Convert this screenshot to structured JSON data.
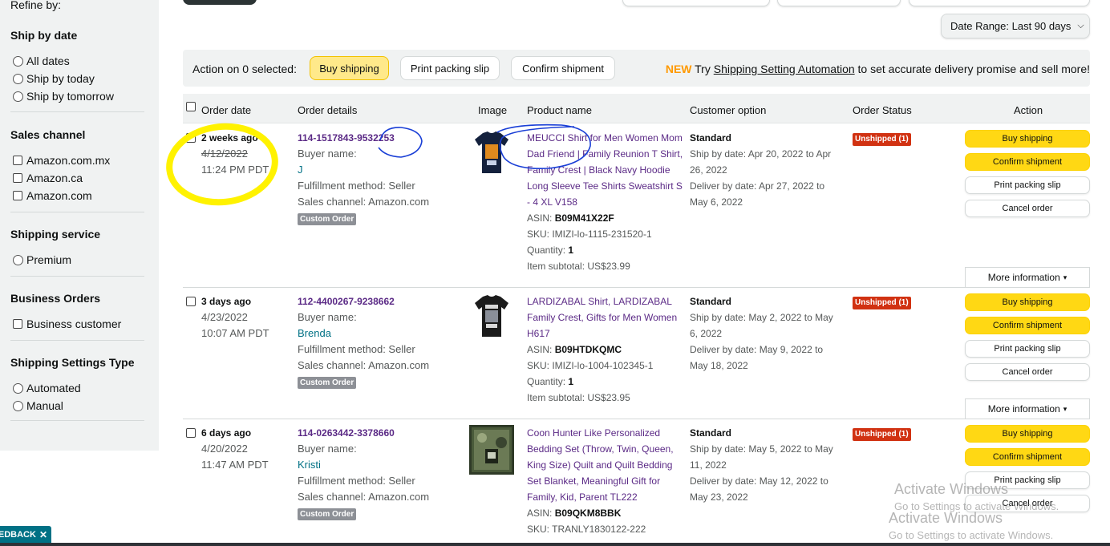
{
  "sidebar": {
    "refine_label": "Refine by:",
    "ship_by_date": {
      "heading": "Ship by date",
      "options": [
        "All dates",
        "Ship by today",
        "Ship by tomorrow"
      ]
    },
    "sales_channel": {
      "heading": "Sales channel",
      "options": [
        "Amazon.com.mx",
        "Amazon.ca",
        "Amazon.com"
      ]
    },
    "shipping_service": {
      "heading": "Shipping service",
      "options": [
        "Premium"
      ]
    },
    "business_orders": {
      "heading": "Business Orders",
      "options": [
        "Business customer"
      ]
    },
    "shipping_settings_type": {
      "heading": "Shipping Settings Type",
      "options": [
        "Automated",
        "Manual"
      ]
    }
  },
  "date_range": {
    "label": "Date Range: Last 90 days"
  },
  "action_bar": {
    "selected_label": "Action on 0 selected:",
    "buy_shipping": "Buy shipping",
    "print_packing_slip": "Print packing slip",
    "confirm_shipment": "Confirm shipment",
    "promo_new": "NEW",
    "promo_try": "Try",
    "promo_link": "Shipping Setting Automation",
    "promo_rest": "to set accurate delivery promise and sell more!"
  },
  "table": {
    "headers": {
      "order_date": "Order date",
      "order_details": "Order details",
      "image": "Image",
      "product_name": "Product name",
      "customer_option": "Customer option",
      "order_status": "Order Status",
      "action": "Action"
    },
    "orders": [
      {
        "age": "2 weeks ago",
        "date": "4/12/2022",
        "time": "11:24 PM PDT",
        "order_id": "114-1517843-9532253",
        "buyer_label": "Buyer name:",
        "buyer": "J",
        "fulfillment": "Fulfillment method: Seller",
        "channel": "Sales channel: Amazon.com",
        "badge": "Custom Order",
        "product_name": "MEUCCI Shirt for Men Women Mom Dad Friend | Family Reunion T Shirt, Family Crest | Black Navy Hoodie Long Sleeve Tee Shirts Sweatshirt S - 4 XL V158",
        "asin_label": "ASIN:",
        "asin": "B09M41X22F",
        "sku": "SKU: IMIZI-lo-1115-231520-1",
        "qty_label": "Quantity:",
        "qty": "1",
        "subtotal": "Item subtotal: US$23.99",
        "shipping": "Standard",
        "ship_by": "Ship by date: Apr 20, 2022 to Apr 26, 2022",
        "deliver_by": "Deliver by date: Apr 27, 2022 to May 6, 2022",
        "status": "Unshipped (1)",
        "btn_buy": "Buy shipping",
        "btn_confirm": "Confirm shipment",
        "btn_print": "Print packing slip",
        "btn_cancel": "Cancel order",
        "more_info": "More information"
      },
      {
        "age": "3 days ago",
        "date": "4/23/2022",
        "time": "10:07 AM PDT",
        "order_id": "112-4400267-9238662",
        "buyer_label": "Buyer name:",
        "buyer": "Brenda",
        "fulfillment": "Fulfillment method: Seller",
        "channel": "Sales channel: Amazon.com",
        "badge": "Custom Order",
        "product_name": "LARDIZABAL Shirt, LARDIZABAL Family Crest, Gifts for Men Women H617",
        "asin_label": "ASIN:",
        "asin": "B09HTDKQMC",
        "sku": "SKU: IMIZI-lo-1004-102345-1",
        "qty_label": "Quantity:",
        "qty": "1",
        "subtotal": "Item subtotal: US$23.95",
        "shipping": "Standard",
        "ship_by": "Ship by date: May 2, 2022 to May 6, 2022",
        "deliver_by": "Deliver by date: May 9, 2022 to May 18, 2022",
        "status": "Unshipped (1)",
        "btn_buy": "Buy shipping",
        "btn_confirm": "Confirm shipment",
        "btn_print": "Print packing slip",
        "btn_cancel": "Cancel order",
        "more_info": "More information"
      },
      {
        "age": "6 days ago",
        "date": "4/20/2022",
        "time": "11:47 AM PDT",
        "order_id": "114-0263442-3378660",
        "buyer_label": "Buyer name:",
        "buyer": "Kristi",
        "fulfillment": "Fulfillment method: Seller",
        "channel": "Sales channel: Amazon.com",
        "badge": "Custom Order",
        "product_name": "Coon Hunter Like Personalized Bedding Set (Throw, Twin, Queen, King Size) Quilt and Quilt Bedding Set Blanket, Meaningful Gift for Family, Kid, Parent TL222",
        "asin_label": "ASIN:",
        "asin": "B09QKM8BBK",
        "sku": "SKU: TRANLY1830122-222",
        "shipping": "Standard",
        "ship_by": "Ship by date: May 5, 2022 to May 11, 2022",
        "deliver_by": "Deliver by date: May 12, 2022 to May 23, 2022",
        "status": "Unshipped (1)",
        "btn_buy": "Buy shipping",
        "btn_confirm": "Confirm shipment",
        "btn_print": "Print packing slip",
        "btn_cancel": "Cancel order"
      }
    ]
  },
  "feedback": {
    "label": "EEDBACK",
    "close": "✕"
  },
  "watermark": {
    "title": "Activate Windows",
    "subtitle": "Go to Settings to activate Windows."
  },
  "colors": {
    "buy_shipping": "#ffd814",
    "status_red": "#d13212",
    "order_id_purple": "#5b2a86",
    "annotation_yellow": "#fff200",
    "annotation_blue": "#1a3fd6"
  },
  "icons": [
    "chevron-down-icon",
    "close-icon"
  ]
}
